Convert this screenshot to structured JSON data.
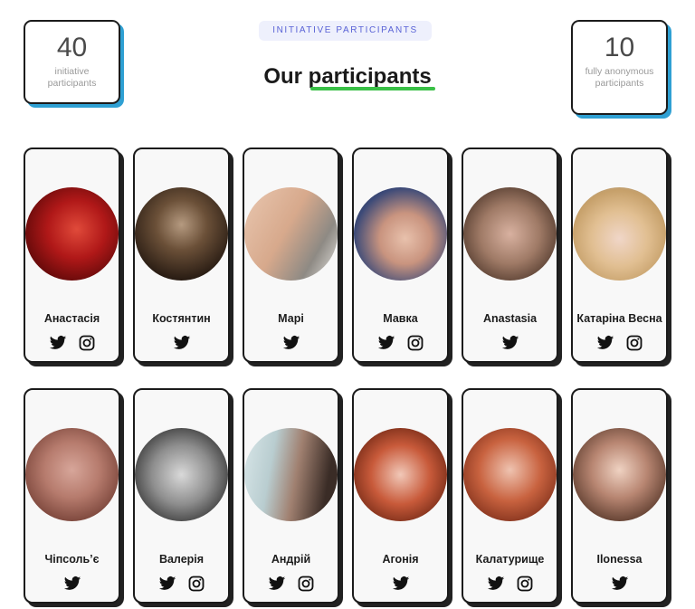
{
  "stats": {
    "left": {
      "value": "40",
      "label": "initiative participants"
    },
    "right": {
      "value": "10",
      "label": "fully anonymous participants"
    }
  },
  "header": {
    "tag": "INITIATIVE PARTICIPANTS",
    "title_prefix": "Our",
    "title_highlight": "participants"
  },
  "colors": {
    "accent_blue": "#2fa0d3",
    "underline_green": "#39c046",
    "tag_text": "#5a63d6"
  },
  "participants": [
    {
      "name": "Анастасія",
      "icons": [
        "twitter-icon",
        "instagram-icon"
      ],
      "photo": "red-toned-portrait"
    },
    {
      "name": "Костянтин",
      "icons": [
        "twitter-icon"
      ],
      "photo": "man-in-jacket"
    },
    {
      "name": "Марі",
      "icons": [
        "twitter-icon"
      ],
      "photo": "woman-light-portrait"
    },
    {
      "name": "Мавка",
      "icons": [
        "twitter-icon",
        "instagram-icon"
      ],
      "photo": "woman-blue-hair"
    },
    {
      "name": "Anastasia",
      "icons": [
        "twitter-icon"
      ],
      "photo": "woman-glasses"
    },
    {
      "name": "Катаріна Весна",
      "icons": [
        "twitter-icon",
        "instagram-icon"
      ],
      "photo": "blonde-woman"
    },
    {
      "name": "Чіпсоль’є",
      "icons": [
        "twitter-icon"
      ],
      "photo": "blurred-portrait"
    },
    {
      "name": "Валерія",
      "icons": [
        "twitter-icon",
        "instagram-icon"
      ],
      "photo": "black-white-portrait"
    },
    {
      "name": "Андрій",
      "icons": [
        "twitter-icon",
        "instagram-icon"
      ],
      "photo": "bearded-man"
    },
    {
      "name": "Агонія",
      "icons": [
        "twitter-icon"
      ],
      "photo": "red-hair-woman"
    },
    {
      "name": "Калатурище",
      "icons": [
        "twitter-icon",
        "instagram-icon"
      ],
      "photo": "smiling-red-hair-woman"
    },
    {
      "name": "Ilonessa",
      "icons": [
        "twitter-icon"
      ],
      "photo": "brown-hair-woman"
    }
  ]
}
